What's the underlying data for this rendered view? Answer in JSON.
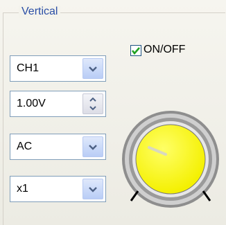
{
  "group": {
    "title": "Vertical"
  },
  "channel_select": {
    "value": "CH1"
  },
  "volts_spin": {
    "value": "1.00V"
  },
  "coupling_select": {
    "value": "AC"
  },
  "probe_select": {
    "value": "x1"
  },
  "on_off": {
    "label": "ON/OFF",
    "checked": true
  },
  "colors": {
    "knob": "#ffff33",
    "accent": "#2a4ea6",
    "check": "#21a121"
  }
}
